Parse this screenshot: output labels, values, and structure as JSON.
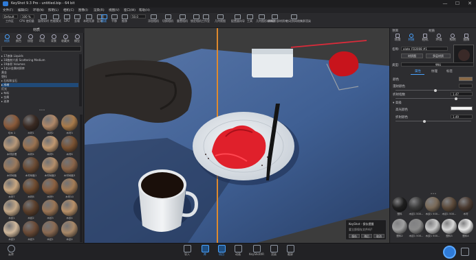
{
  "window": {
    "title": "KeyShot 9.3 Pro - untitled.bip - 64 bit",
    "controls": {
      "minimize": "—",
      "maximize": "☐",
      "close": "✕"
    }
  },
  "menubar": [
    "文件(F)",
    "编辑(E)",
    "环境(N)",
    "照明(L)",
    "相机(C)",
    "图像(I)",
    "渲染(R)",
    "视图(V)",
    "窗口(W)",
    "帮助(H)"
  ],
  "toolbar": {
    "workspace_select": "Default",
    "zoom_select": "100 %",
    "items": [
      "工作区",
      "CPU 使用量",
      "暂停实时",
      "性能模式",
      "GPU",
      "去噪",
      "本地光源",
      "区域",
      "翻滚",
      "平移",
      "推移",
      "添加相机",
      "切换相机",
      "重置相机",
      "锁定相机",
      "工作室",
      "几何视图",
      "配置器向导",
      "工具",
      "几何图形编辑器",
      "刷新外部材质库",
      "启动到网络集群渲染"
    ],
    "fov_value": "50.0"
  },
  "left_panel": {
    "title": "材质",
    "tabs": [
      {
        "label": "材质",
        "icon": "material-icon",
        "active": true
      },
      {
        "label": "颜色",
        "icon": "color-icon",
        "active": false
      },
      {
        "label": "纹理",
        "icon": "texture-icon",
        "active": false
      },
      {
        "label": "环境",
        "icon": "environment-icon",
        "active": false
      },
      {
        "label": "背景",
        "icon": "background-icon",
        "active": false
      },
      {
        "label": "收藏夹",
        "icon": "favorites-icon",
        "active": false
      },
      {
        "label": "模型",
        "icon": "model-icon",
        "active": false
      }
    ],
    "tree": [
      {
        "label": "▸ 17液体 Liquids",
        "selected": false
      },
      {
        "label": "▸ 18散射介质 Scattering Medium",
        "selected": false
      },
      {
        "label": "▸ 19体积 Volumes",
        "selected": false
      },
      {
        "label": "▾ 1金计金属材质库",
        "selected": false
      },
      {
        "label": "    黄金",
        "selected": false
      },
      {
        "label": "    塑料",
        "selected": false
      },
      {
        "label": "  ▸ 石料和宝石",
        "selected": false
      },
      {
        "label": "  ▸ 木材",
        "selected": true
      },
      {
        "label": "    灯光",
        "selected": false
      },
      {
        "label": "  ▸ 布料",
        "selected": false
      },
      {
        "label": "  ▸ 金属",
        "selected": false
      },
      {
        "label": "  ▸ 油漆",
        "selected": false
      }
    ],
    "materials": [
      {
        "label": "切木 1",
        "color": "#8a5a3a"
      },
      {
        "label": "木材1",
        "color": "#3a2a22"
      },
      {
        "label": "木材2",
        "color": "#b08868"
      },
      {
        "label": "木材3",
        "color": "#a87a4a"
      },
      {
        "label": "木材纹理",
        "color": "#b89878"
      },
      {
        "label": "木材4",
        "color": "#9a7250"
      },
      {
        "label": "木材5",
        "color": "#c09870"
      },
      {
        "label": "木材6",
        "color": "#7a5232"
      },
      {
        "label": "木材地板",
        "color": "#9c7a5c"
      },
      {
        "label": "木材地板1",
        "color": "#6a4a32"
      },
      {
        "label": "木材地板2",
        "color": "#b48e6a"
      },
      {
        "label": "木材地板3",
        "color": "#8a6448"
      },
      {
        "label": "木材7",
        "color": "#c8a680"
      },
      {
        "label": "木材8",
        "color": "#6e4a2e"
      },
      {
        "label": "木材9",
        "color": "#8c6040"
      },
      {
        "label": "木材10",
        "color": "#a47c56"
      },
      {
        "label": "木纹1",
        "color": "#c4a888"
      },
      {
        "label": "木纹2",
        "color": "#5a3e2a"
      },
      {
        "label": "木纹3",
        "color": "#9a7454"
      },
      {
        "label": "木纹4",
        "color": "#b89068"
      },
      {
        "label": "木纹2",
        "color": "#d0b89c"
      },
      {
        "label": "木纹3",
        "color": "#6a4a36"
      },
      {
        "label": "木纹1",
        "color": "#8a6a52"
      },
      {
        "label": "木纹4",
        "color": "#a88868"
      }
    ]
  },
  "right_panel": {
    "title": "材质",
    "project_label": "项目",
    "tabs": [
      "场景",
      "材质",
      "相机",
      "环境",
      "照明",
      "图像"
    ],
    "name_label": "名称:",
    "name_value": "plate_FD2008 #1",
    "graph_button": "材质图",
    "multi_button": "多层材质",
    "type_label": "类型:",
    "type_value": "塑料",
    "sub_tabs": [
      "属性",
      "纹理",
      "标签"
    ],
    "props": [
      {
        "label": "颜色",
        "value": ""
      },
      {
        "label": "漫射颜色",
        "value": ""
      },
      {
        "label": "折射指数",
        "value": "1.47"
      }
    ],
    "adv_header": "高级",
    "adv_props": [
      {
        "label": "高光颜色",
        "value": ""
      },
      {
        "label": "折射颜色",
        "value": "1.49"
      }
    ],
    "bottom_materials": [
      {
        "label": "塑料",
        "color": "#1e1e1e"
      },
      {
        "label": "木纹1 500...",
        "color": "#3a3a3a"
      },
      {
        "label": "木纹1 500...",
        "color": "#7a6a58"
      },
      {
        "label": "木纹1 500...",
        "color": "#5c4a3a"
      },
      {
        "label": "木材",
        "color": "#4a3a30"
      },
      {
        "label": "塑料2",
        "color": "#a0a0a0"
      },
      {
        "label": "木纹1 500...",
        "color": "#8a8a8a"
      },
      {
        "label": "木纹1 500...",
        "color": "#c8c8c8"
      },
      {
        "label": "塑料3",
        "color": "#d8d8d8"
      },
      {
        "label": "塑料4",
        "color": "#e8e8e8"
      }
    ]
  },
  "bottom_bar": {
    "cloud_label": "云库",
    "items": [
      {
        "label": "导入",
        "icon": "import-icon",
        "active": false
      },
      {
        "label": "库",
        "icon": "library-icon",
        "active": true
      },
      {
        "label": "项目",
        "icon": "project-icon",
        "active": true
      },
      {
        "label": "动画",
        "icon": "animation-icon",
        "active": false
      },
      {
        "label": "KeyShotXR",
        "icon": "keyshotxr-icon",
        "active": false
      },
      {
        "label": "渲染",
        "icon": "render-icon",
        "active": false
      },
      {
        "label": "截屏",
        "icon": "screenshot-icon",
        "active": false
      }
    ]
  },
  "toast": {
    "title": "KeyShot - 保存提醒",
    "message": "要立即保存文件吗?",
    "buttons": [
      "保存",
      "稍后",
      "取消"
    ]
  },
  "colors": {
    "accent": "#4aa3ff",
    "arrow": "#d92b3a",
    "table": "#3f5f93",
    "plate": "#e9edf0",
    "cake": "#e0202b"
  }
}
